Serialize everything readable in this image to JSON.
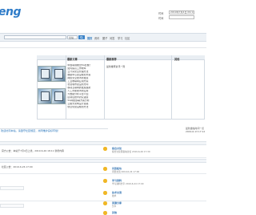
{
  "brand": {
    "logo_text": "eng"
  },
  "header": {
    "time_label_1": "时间",
    "time_value_1": "2019年7月4日 09:14",
    "time_label_2": "时间",
    "time_value_2": "",
    "chat_label": ""
  },
  "search": {
    "placeholder": "",
    "scope": "全站",
    "button": "搜"
  },
  "nav": [
    "首页",
    "资讯",
    "圈子",
    "问答",
    "学习",
    "社区"
  ],
  "strip_text": "",
  "panel": {
    "col_news": "最新文章",
    "col_recommend": "最新推荐",
    "col_other": "其他",
    "news": [
      "中国联通推出5G套餐？",
      "如何提高工作效率",
      "云计算安全管理方法",
      "数据中心建设规划方案",
      "网络安全技术的发展",
      "工业物联网应用方案",
      "智慧城市建设新方向",
      "移动互联网的发展趋势",
      "人工智能技术的应用",
      "大数据分析平台介绍",
      "区块链技术研究进展",
      "5G网络部署方案分析",
      "云服务架构设计思路",
      "信息化建设规划方法"
    ],
    "recommend_item": "最新推荐资讯一则"
  },
  "notice": "欢迎访问本站，请遵守社区规定，共同维护良好环境！",
  "right_notes": [
    "最新发帖时间一览",
    "2019-6-13 17:12"
  ],
  "list_lines": [
    "官方公告：本站于7月4日上线，2019-6-26 18:11 新增内容",
    "社区公告：2019-6-26 17:00",
    "",
    "",
    ""
  ],
  "feed": [
    {
      "title": "综合讨论",
      "sub": "综合讨论区版块讨论  2019-6-26 17:39"
    },
    {
      "title": "问答板块",
      "sub": "问答交流 2019-6-24 17:00"
    },
    {
      "title": "学习资料",
      "sub": "学习资料分享 2019-6-24 17:00"
    },
    {
      "title": "技术交流",
      "sub": "技术"
    },
    {
      "title": "资源分享",
      "sub": "分享"
    },
    {
      "title": "其他",
      "sub": ""
    }
  ],
  "colors": {
    "brand": "#2d7bc8",
    "feed_dot": "#f0b726",
    "nav_bg": "#eef2f6",
    "link": "#1f6fb8"
  }
}
